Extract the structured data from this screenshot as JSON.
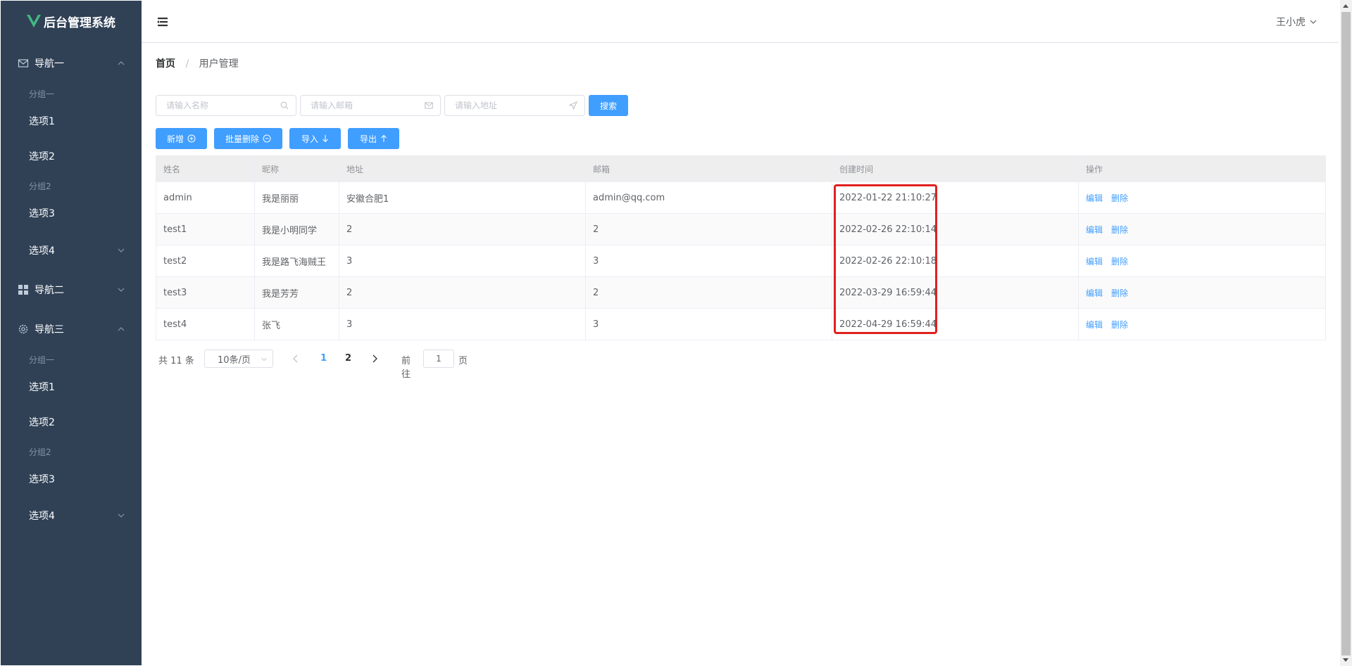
{
  "app": {
    "title": "后台管理系统",
    "user_name": "王小虎"
  },
  "sidebar": {
    "nav1": {
      "title": "导航一",
      "group1": "分组一",
      "item1": "选项1",
      "item2": "选项2",
      "group2": "分组2",
      "item3": "选项3",
      "item4": "选项4"
    },
    "nav2": {
      "title": "导航二"
    },
    "nav3": {
      "title": "导航三",
      "group1": "分组一",
      "item1": "选项1",
      "item2": "选项2",
      "group2": "分组2",
      "item3": "选项3",
      "item4": "选项4"
    }
  },
  "breadcrumb": {
    "home": "首页",
    "separator": "/",
    "current": "用户管理"
  },
  "search": {
    "name_placeholder": "请输入名称",
    "email_placeholder": "请输入邮箱",
    "address_placeholder": "请输入地址",
    "button": "搜索"
  },
  "toolbar": {
    "add": "新增",
    "batch_delete": "批量删除",
    "import": "导入",
    "export": "导出"
  },
  "table": {
    "headers": [
      "姓名",
      "昵称",
      "地址",
      "邮箱",
      "创建时间",
      "操作"
    ],
    "rows": [
      [
        "admin",
        "我是丽丽",
        "安徽合肥1",
        "admin@qq.com",
        "2022-01-22 21:10:27"
      ],
      [
        "test1",
        "我是小明同学",
        "2",
        "2",
        "2022-02-26 22:10:14"
      ],
      [
        "test2",
        "我是路飞海贼王",
        "3",
        "3",
        "2022-02-26 22:10:18"
      ],
      [
        "test3",
        "我是芳芳",
        "2",
        "2",
        "2022-03-29 16:59:44"
      ],
      [
        "test4",
        "张飞",
        "3",
        "3",
        "2022-04-29 16:59:44"
      ]
    ],
    "edit_label": "编辑",
    "delete_label": "删除"
  },
  "pagination": {
    "total": "共 11 条",
    "page_size": "10条/页",
    "pages": [
      "1",
      "2"
    ],
    "current_page": "1",
    "goto_label": "前往",
    "goto_value": "1",
    "page_word": "页"
  },
  "colors": {
    "sidebar_bg": "#304156",
    "primary": "#409eff",
    "highlight_box": "#e02020",
    "logo_green": "#41b883"
  }
}
